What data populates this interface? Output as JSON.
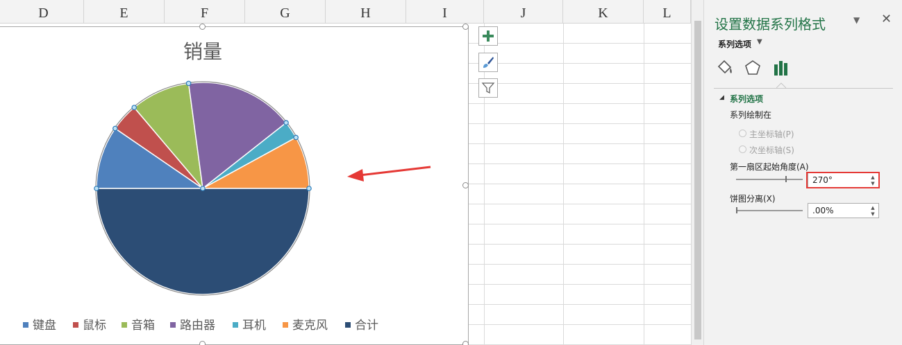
{
  "sheet": {
    "columns": [
      "D",
      "E",
      "F",
      "G",
      "H",
      "I",
      "J",
      "K",
      "L"
    ]
  },
  "chart": {
    "title": "销量",
    "legend": [
      {
        "label": "键盘",
        "color": "#4f81bd"
      },
      {
        "label": "鼠标",
        "color": "#c0504d"
      },
      {
        "label": "音箱",
        "color": "#9bbb59"
      },
      {
        "label": "路由器",
        "color": "#8064a2"
      },
      {
        "label": "耳机",
        "color": "#4bacc6"
      },
      {
        "label": "麦克风",
        "color": "#f79646"
      },
      {
        "label": "合计",
        "color": "#2c4d75"
      }
    ],
    "buttons": [
      "chart-elements-icon",
      "chart-styles-icon",
      "chart-filters-icon"
    ]
  },
  "chart_data": {
    "type": "pie",
    "title": "销量",
    "categories": [
      "键盘",
      "鼠标",
      "音箱",
      "路由器",
      "耳机",
      "麦克风",
      "合计"
    ],
    "values": [
      18,
      8,
      17,
      31,
      5,
      15,
      94
    ],
    "first_slice_angle_deg": 270,
    "legend_position": "bottom"
  },
  "pane": {
    "title": "设置数据系列格式",
    "subtitle": "系列选项",
    "tabs": [
      "fill-line-icon",
      "effects-icon",
      "series-options-icon"
    ],
    "section_title": "系列选项",
    "plot_on_label": "系列绘制在",
    "primary_axis": "主坐标轴(P)",
    "secondary_axis": "次坐标轴(S)",
    "angle_label": "第一扇区起始角度(A)",
    "angle_value": "270°",
    "explosion_label": "饼图分离(X)",
    "explosion_value": ".00%",
    "close_symbol": "✕",
    "dropdown_symbol": "▼"
  },
  "annotations": {
    "arrow_color": "#e53935"
  }
}
